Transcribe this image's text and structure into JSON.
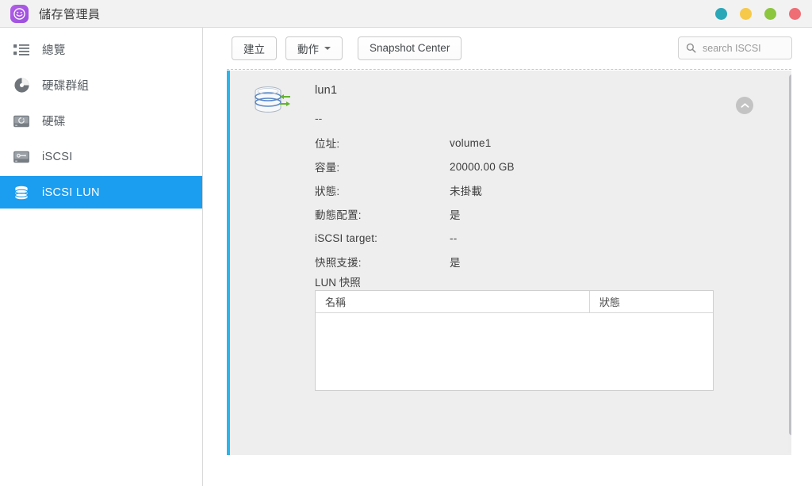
{
  "window": {
    "title": "儲存管理員",
    "app_icon": "storage-manager-icon",
    "controls": [
      {
        "name": "window-control-teal",
        "color": "#23a5b5"
      },
      {
        "name": "window-control-yellow",
        "color": "#f5c council"
      }
    ]
  },
  "window_controls": [
    {
      "name": "window-control-teal",
      "color": "#2ba8b8"
    },
    {
      "name": "window-control-yellow",
      "color": "#f7c94b"
    },
    {
      "name": "window-control-green",
      "color": "#8cc63f"
    },
    {
      "name": "window-control-red",
      "color": "#ef6d75"
    }
  ],
  "colors": {
    "accent_blue": "#1b9df0",
    "panel_accent": "#29b6ec",
    "panel_bg": "#eeeeee",
    "titlebar_bg": "#f2f2f2",
    "app_icon_purple": "#9b4fdd"
  },
  "sidebar": {
    "items": [
      {
        "label": "總覽",
        "icon": "overview-list-icon",
        "active": false
      },
      {
        "label": "硬碟群組",
        "icon": "disk-group-pie-icon",
        "active": false
      },
      {
        "label": "硬碟",
        "icon": "hard-disk-icon",
        "active": false
      },
      {
        "label": "iSCSI",
        "icon": "iscsi-disk-icon",
        "active": false
      },
      {
        "label": "iSCSI LUN",
        "icon": "database-stack-icon",
        "active": true
      }
    ]
  },
  "toolbar": {
    "create_label": "建立",
    "action_label": "動作",
    "snapshot_center_label": "Snapshot Center"
  },
  "search": {
    "placeholder": "search ISCSI",
    "value": "",
    "icon": "search-icon"
  },
  "lun": {
    "icon": "lun-database-sync-icon",
    "name": "lun1",
    "description": "--",
    "collapse_icon": "chevron-up-icon",
    "details": [
      {
        "key": "位址:",
        "value": "volume1"
      },
      {
        "key": "容量:",
        "value": "20000.00 GB"
      },
      {
        "key": "狀態:",
        "value": "未掛載"
      },
      {
        "key": "動態配置:",
        "value": "是"
      },
      {
        "key": "iSCSI target:",
        "value": "--"
      },
      {
        "key": "快照支援:",
        "value": "是"
      }
    ],
    "snapshot_section_title": "LUN 快照",
    "snapshot_table": {
      "columns": [
        "名稱",
        "狀態"
      ],
      "rows": []
    }
  }
}
